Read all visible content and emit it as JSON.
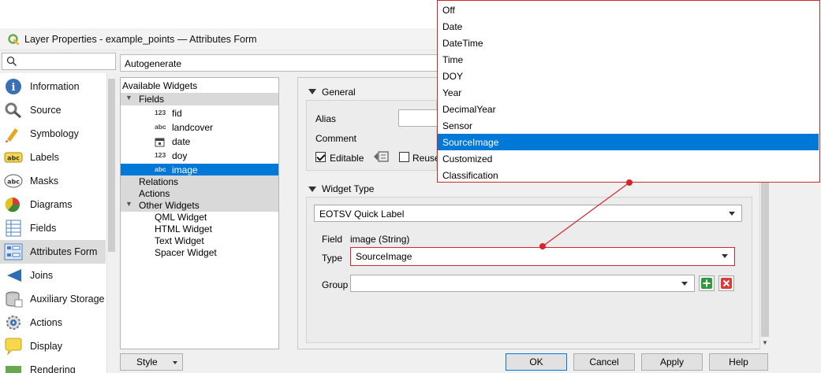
{
  "window": {
    "title": "Layer Properties - example_points — Attributes Form"
  },
  "search": {
    "placeholder": ""
  },
  "sidebar": {
    "items": [
      {
        "label": "Information",
        "icon": "information-icon"
      },
      {
        "label": "Source",
        "icon": "source-icon"
      },
      {
        "label": "Symbology",
        "icon": "symbology-icon"
      },
      {
        "label": "Labels",
        "icon": "labels-icon"
      },
      {
        "label": "Masks",
        "icon": "masks-icon"
      },
      {
        "label": "Diagrams",
        "icon": "diagrams-icon"
      },
      {
        "label": "Fields",
        "icon": "fields-icon"
      },
      {
        "label": "Attributes Form",
        "icon": "attributes-form-icon",
        "active": true
      },
      {
        "label": "Joins",
        "icon": "joins-icon"
      },
      {
        "label": "Auxiliary Storage",
        "icon": "auxiliary-storage-icon"
      },
      {
        "label": "Actions",
        "icon": "actions-icon"
      },
      {
        "label": "Display",
        "icon": "display-icon"
      },
      {
        "label": "Rendering",
        "icon": "rendering-icon"
      }
    ]
  },
  "layout_mode": {
    "value": "Autogenerate"
  },
  "tree": {
    "header": "Available Widgets",
    "fields_label": "Fields",
    "fields": [
      {
        "type": "123",
        "name": "fid"
      },
      {
        "type": "abc",
        "name": "landcover"
      },
      {
        "type": "date",
        "name": "date"
      },
      {
        "type": "123",
        "name": "doy"
      },
      {
        "type": "abc",
        "name": "image",
        "selected": true
      }
    ],
    "relations_label": "Relations",
    "actions_label": "Actions",
    "other_label": "Other Widgets",
    "other": [
      "QML Widget",
      "HTML Widget",
      "Text Widget",
      "Spacer Widget"
    ]
  },
  "general": {
    "title": "General",
    "alias_label": "Alias",
    "comment_label": "Comment",
    "editable_label": "Editable",
    "editable_checked": true,
    "reuse_label": "Reuse"
  },
  "widget_type": {
    "title": "Widget Type",
    "selected": "EOTSV Quick Label",
    "field_label": "Field",
    "field_value": "image (String)",
    "type_label": "Type",
    "type_value": "SourceImage",
    "group_label": "Group",
    "group_value": ""
  },
  "buttons": {
    "style": "Style",
    "ok": "OK",
    "cancel": "Cancel",
    "apply": "Apply",
    "help": "Help"
  },
  "popup": {
    "options": [
      "Off",
      "Date",
      "DateTime",
      "Time",
      "DOY",
      "Year",
      "DecimalYear",
      "Sensor",
      "SourceImage",
      "Customized",
      "Classification"
    ],
    "selected": "SourceImage"
  },
  "colors": {
    "accent": "#0078d7",
    "highlight": "#d1262a"
  }
}
